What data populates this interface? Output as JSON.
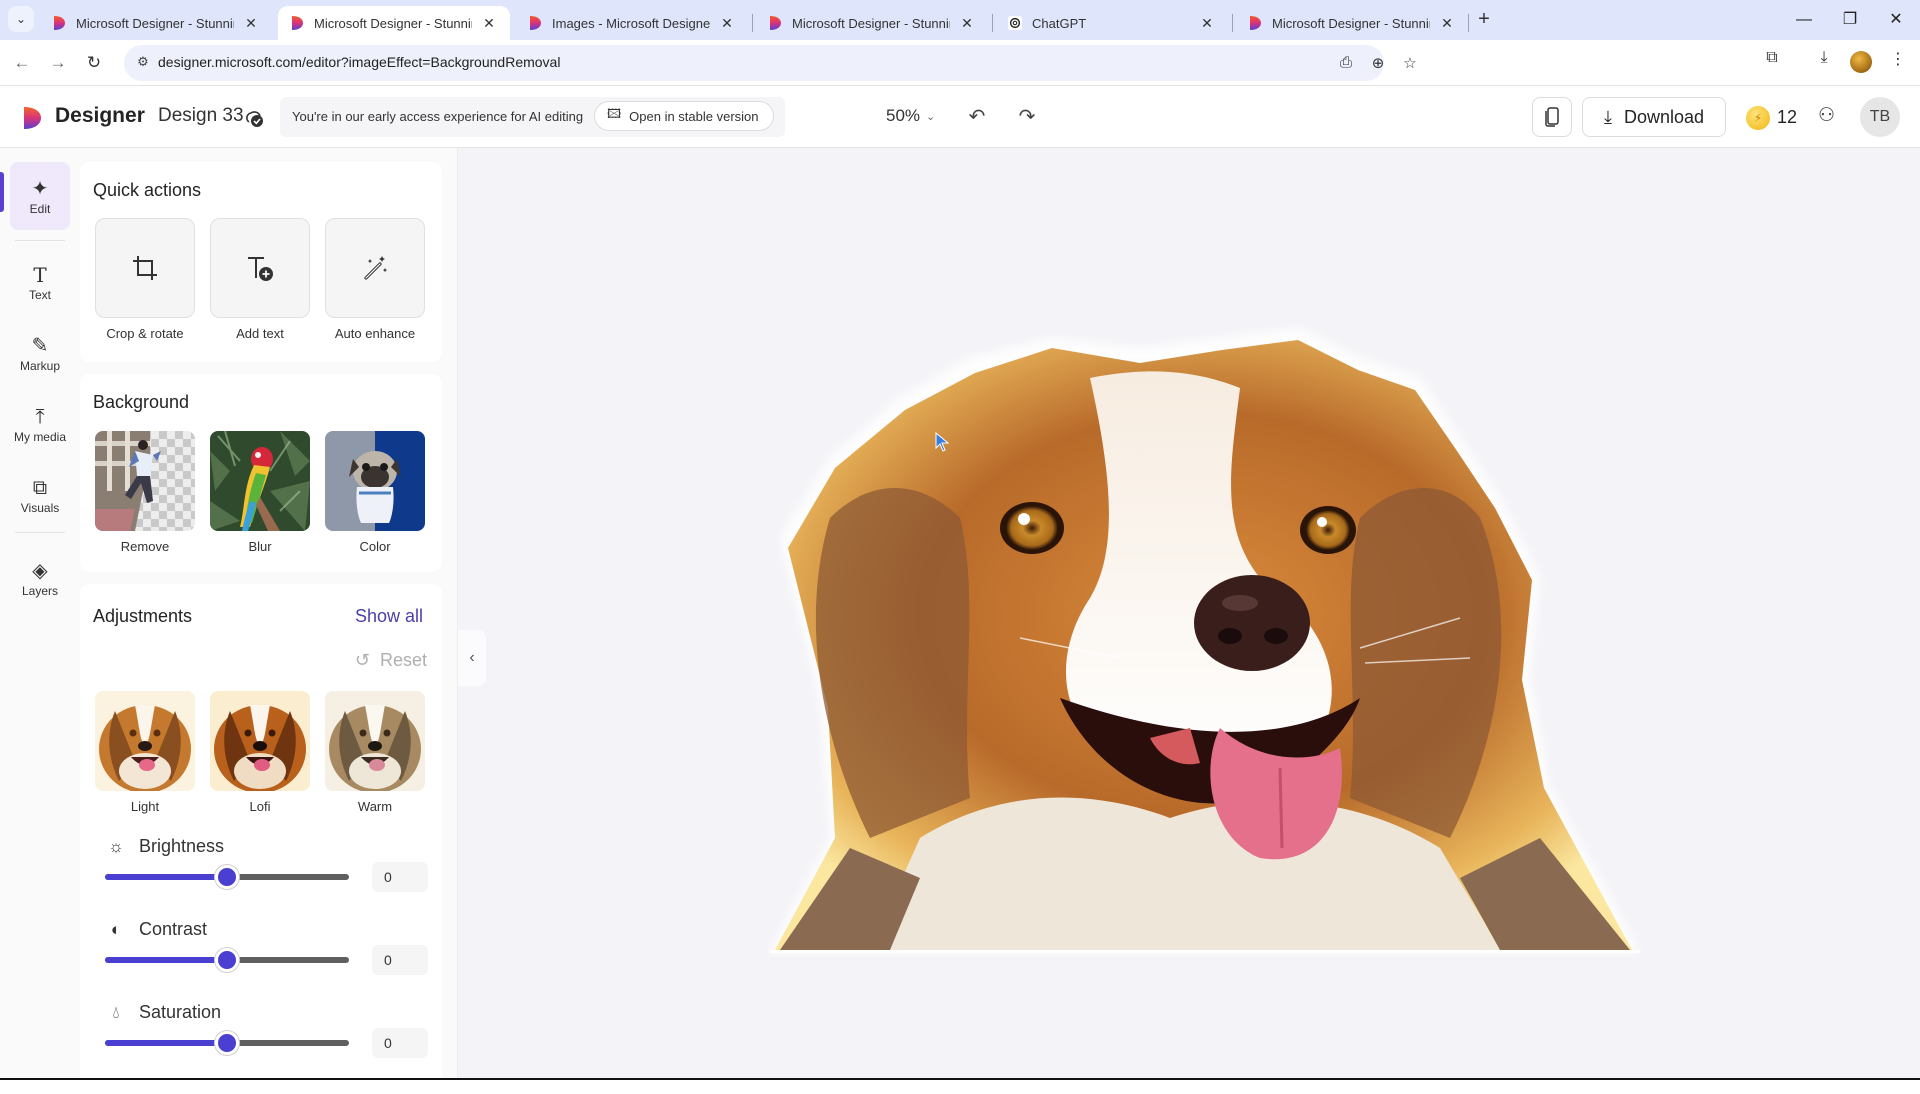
{
  "browser": {
    "tabs": [
      {
        "title": "Microsoft Designer - Stunning d",
        "favicon": "designer-logo",
        "active": false
      },
      {
        "title": "Microsoft Designer - Stunning d",
        "favicon": "designer-logo",
        "active": true
      },
      {
        "title": "Images - Microsoft Designer",
        "favicon": "designer-logo",
        "active": false
      },
      {
        "title": "Microsoft Designer - Stunning d",
        "favicon": "designer-logo",
        "active": false
      },
      {
        "title": "ChatGPT",
        "favicon": "chatgpt-logo",
        "active": false
      },
      {
        "title": "Microsoft Designer - Stunning d",
        "favicon": "designer-logo",
        "active": false
      }
    ],
    "close_glyph": "✕",
    "new_tab_glyph": "+",
    "window_controls": {
      "minimize": "—",
      "restore": "❐",
      "close": "✕"
    },
    "url": "designer.microsoft.com/editor?imageEffect=BackgroundRemoval",
    "nav": {
      "back": "←",
      "forward": "→",
      "reload": "↻"
    }
  },
  "header": {
    "brand": "Designer",
    "design_name": "Design 33",
    "early_access_text": "You're in our early access experience for AI editing",
    "open_stable_label": "Open in stable version",
    "zoom_level": "50%",
    "download_label": "Download",
    "coin_count": "12",
    "user_initials": "TB"
  },
  "rail": {
    "items": [
      {
        "label": "Edit",
        "icon": "sparkle-icon",
        "glyph": "✦",
        "active": true
      },
      {
        "label": "Text",
        "icon": "text-icon",
        "glyph": "T",
        "active": false
      },
      {
        "label": "Markup",
        "icon": "pen-icon",
        "glyph": "✎",
        "active": false
      },
      {
        "label": "My media",
        "icon": "upload-icon",
        "glyph": "⤒",
        "active": false
      },
      {
        "label": "Visuals",
        "icon": "visuals-icon",
        "glyph": "⧉",
        "active": false
      },
      {
        "label": "Layers",
        "icon": "layers-icon",
        "glyph": "◈",
        "active": false
      }
    ]
  },
  "panel": {
    "quick_actions": {
      "title": "Quick actions",
      "items": [
        {
          "label": "Crop & rotate",
          "icon": "crop-icon"
        },
        {
          "label": "Add text",
          "icon": "add-text-icon"
        },
        {
          "label": "Auto enhance",
          "icon": "magic-wand-icon"
        }
      ]
    },
    "background": {
      "title": "Background",
      "items": [
        {
          "label": "Remove"
        },
        {
          "label": "Blur"
        },
        {
          "label": "Color"
        }
      ]
    },
    "adjustments": {
      "title": "Adjustments",
      "show_all_label": "Show all",
      "reset_label": "Reset",
      "filters": [
        {
          "label": "Light"
        },
        {
          "label": "Lofi"
        },
        {
          "label": "Warm"
        }
      ],
      "sliders": [
        {
          "label": "Brightness",
          "icon": "sun-icon",
          "value": "0",
          "position_fraction": 0.5
        },
        {
          "label": "Contrast",
          "icon": "contrast-icon",
          "value": "0",
          "position_fraction": 0.5
        },
        {
          "label": "Saturation",
          "icon": "droplet-icon",
          "value": "0",
          "position_fraction": 0.5
        }
      ]
    }
  },
  "colors": {
    "accent": "#4b3fd1",
    "link": "#4b3fa8",
    "canvas_bg": "#f4f3f7",
    "tabstrip_bg": "#dfe6fb"
  }
}
